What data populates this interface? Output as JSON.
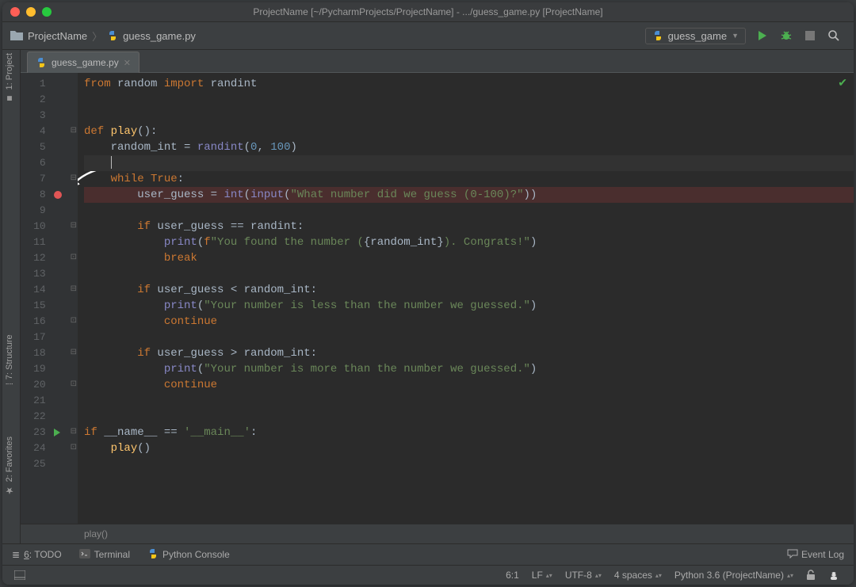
{
  "window": {
    "title": "ProjectName [~/PycharmProjects/ProjectName] - .../guess_game.py [ProjectName]"
  },
  "breadcrumb": {
    "project": "ProjectName",
    "file": "guess_game.py"
  },
  "run_config": {
    "name": "guess_game"
  },
  "tab": {
    "label": "guess_game.py"
  },
  "sidebar_tools": {
    "project": "1: Project",
    "structure": "7: Structure",
    "favorites": "2: Favorites"
  },
  "code": {
    "lines": [
      {
        "n": 1,
        "tokens": [
          [
            "kw",
            "from"
          ],
          [
            "p",
            " random "
          ],
          [
            "kw",
            "import"
          ],
          [
            "p",
            " randint"
          ]
        ]
      },
      {
        "n": 2,
        "tokens": []
      },
      {
        "n": 3,
        "tokens": []
      },
      {
        "n": 4,
        "tokens": [
          [
            "kw",
            "def "
          ],
          [
            "fn",
            "play"
          ],
          [
            "p",
            "():"
          ]
        ],
        "fold": "open"
      },
      {
        "n": 5,
        "tokens": [
          [
            "p",
            "    random_int = "
          ],
          [
            "bi",
            "randint"
          ],
          [
            "p",
            "("
          ],
          [
            "num",
            "0"
          ],
          [
            "p",
            ", "
          ],
          [
            "num",
            "100"
          ],
          [
            "p",
            ")"
          ]
        ]
      },
      {
        "n": 6,
        "tokens": [
          [
            "p",
            "    "
          ],
          [
            "caret",
            ""
          ]
        ],
        "current": true
      },
      {
        "n": 7,
        "tokens": [
          [
            "p",
            "    "
          ],
          [
            "kw",
            "while"
          ],
          [
            "p",
            " "
          ],
          [
            "kw",
            "True"
          ],
          [
            "p",
            ":"
          ]
        ],
        "fold": "open"
      },
      {
        "n": 8,
        "tokens": [
          [
            "p",
            "        user_guess = "
          ],
          [
            "bi",
            "int"
          ],
          [
            "p",
            "("
          ],
          [
            "bi",
            "input"
          ],
          [
            "p",
            "("
          ],
          [
            "str",
            "\"What number did we guess (0-100)?\""
          ],
          [
            "p",
            "))"
          ]
        ],
        "breakpoint": true
      },
      {
        "n": 9,
        "tokens": []
      },
      {
        "n": 10,
        "tokens": [
          [
            "p",
            "        "
          ],
          [
            "kw",
            "if"
          ],
          [
            "p",
            " user_guess == randint:"
          ]
        ],
        "fold": "open"
      },
      {
        "n": 11,
        "tokens": [
          [
            "p",
            "            "
          ],
          [
            "bi",
            "print"
          ],
          [
            "p",
            "("
          ],
          [
            "kw",
            "f"
          ],
          [
            "str",
            "\"You found the number ("
          ],
          [
            "p",
            "{"
          ],
          [
            "p",
            "random_int"
          ],
          [
            "p",
            "}"
          ],
          [
            "str",
            "). Congrats!\""
          ],
          [
            "p",
            ")"
          ]
        ]
      },
      {
        "n": 12,
        "tokens": [
          [
            "p",
            "            "
          ],
          [
            "kw",
            "break"
          ]
        ],
        "fold": "close"
      },
      {
        "n": 13,
        "tokens": []
      },
      {
        "n": 14,
        "tokens": [
          [
            "p",
            "        "
          ],
          [
            "kw",
            "if"
          ],
          [
            "p",
            " user_guess < random_int:"
          ]
        ],
        "fold": "open"
      },
      {
        "n": 15,
        "tokens": [
          [
            "p",
            "            "
          ],
          [
            "bi",
            "print"
          ],
          [
            "p",
            "("
          ],
          [
            "str",
            "\"Your number is less than the number we guessed.\""
          ],
          [
            "p",
            ")"
          ]
        ]
      },
      {
        "n": 16,
        "tokens": [
          [
            "p",
            "            "
          ],
          [
            "kw",
            "continue"
          ]
        ],
        "fold": "close"
      },
      {
        "n": 17,
        "tokens": []
      },
      {
        "n": 18,
        "tokens": [
          [
            "p",
            "        "
          ],
          [
            "kw",
            "if"
          ],
          [
            "p",
            " user_guess > random_int:"
          ]
        ],
        "fold": "open"
      },
      {
        "n": 19,
        "tokens": [
          [
            "p",
            "            "
          ],
          [
            "bi",
            "print"
          ],
          [
            "p",
            "("
          ],
          [
            "str",
            "\"Your number is more than the number we guessed.\""
          ],
          [
            "p",
            ")"
          ]
        ]
      },
      {
        "n": 20,
        "tokens": [
          [
            "p",
            "            "
          ],
          [
            "kw",
            "continue"
          ]
        ],
        "fold": "close"
      },
      {
        "n": 21,
        "tokens": []
      },
      {
        "n": 22,
        "tokens": []
      },
      {
        "n": 23,
        "tokens": [
          [
            "kw",
            "if"
          ],
          [
            "p",
            " __name__ == "
          ],
          [
            "str",
            "'__main__'"
          ],
          [
            "p",
            ":"
          ]
        ],
        "fold": "open",
        "run_marker": true
      },
      {
        "n": 24,
        "tokens": [
          [
            "p",
            "    "
          ],
          [
            "fn",
            "play"
          ],
          [
            "p",
            "()"
          ]
        ],
        "fold": "close"
      },
      {
        "n": 25,
        "tokens": []
      }
    ]
  },
  "crumb_footer": "play()",
  "bottom_tools": {
    "todo": "6: TODO",
    "terminal": "Terminal",
    "python_console": "Python Console",
    "event_log": "Event Log"
  },
  "status": {
    "cursor": "6:1",
    "line_sep": "LF",
    "encoding": "UTF-8",
    "indent": "4 spaces",
    "interpreter": "Python 3.6 (ProjectName)"
  }
}
